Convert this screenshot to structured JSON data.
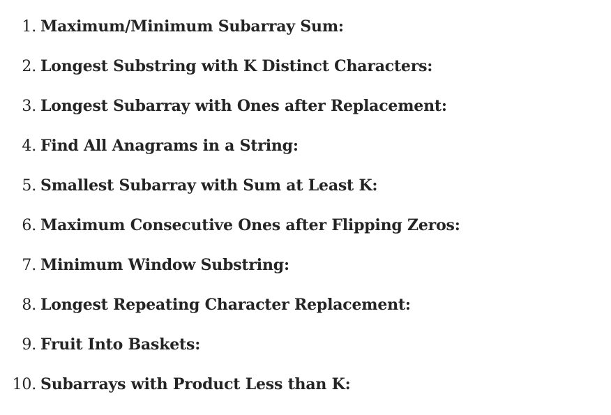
{
  "list": {
    "items": [
      {
        "number": "1.",
        "label": "Maximum/Minimum Subarray Sum:"
      },
      {
        "number": "2.",
        "label": "Longest Substring with K Distinct Characters:"
      },
      {
        "number": "3.",
        "label": "Longest Subarray with Ones after Replacement:"
      },
      {
        "number": "4.",
        "label": "Find All Anagrams in a String:"
      },
      {
        "number": "5.",
        "label": "Smallest Subarray with Sum at Least K:"
      },
      {
        "number": "6.",
        "label": "Maximum Consecutive Ones after Flipping Zeros:"
      },
      {
        "number": "7.",
        "label": "Minimum Window Substring:"
      },
      {
        "number": "8.",
        "label": "Longest Repeating Character Replacement:"
      },
      {
        "number": "9.",
        "label": "Fruit Into Baskets:"
      },
      {
        "number": "10.",
        "label": "Subarrays with Product Less than K:"
      }
    ]
  }
}
